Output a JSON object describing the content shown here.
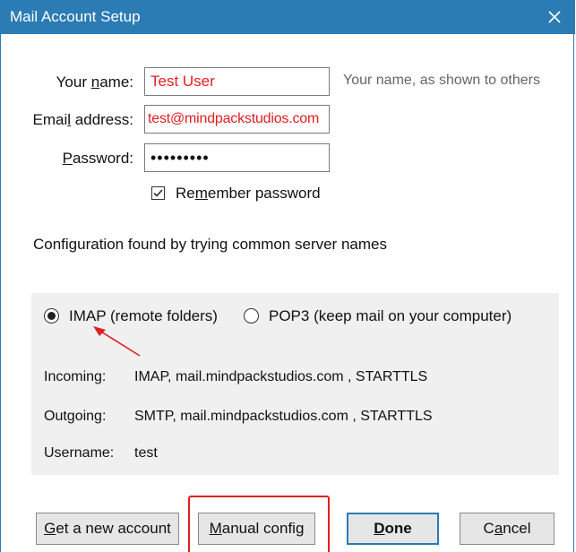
{
  "window": {
    "title": "Mail Account Setup"
  },
  "form": {
    "name_label_pre": "Your ",
    "name_label_key": "n",
    "name_label_post": "ame:",
    "name_value": "Test User",
    "name_hint": "Your name, as shown to others",
    "email_label_pre": "Emai",
    "email_label_key": "l",
    "email_label_post": " address:",
    "email_value": "test@mindpackstudios.com",
    "password_label_key": "P",
    "password_label_post": "assword:",
    "password_value": "•••••••••",
    "remember_pre": "Re",
    "remember_key": "m",
    "remember_post": "ember password",
    "remember_checked": true
  },
  "status": {
    "message": "Configuration found by trying common server names"
  },
  "config": {
    "imap_label": "IMAP (remote folders)",
    "pop3_label": "POP3 (keep mail on your computer)",
    "selected": "IMAP",
    "incoming_label": "Incoming:",
    "incoming_value": "IMAP, mail.mindpackstudios.com , STARTTLS",
    "outgoing_label": "Outgoing:",
    "outgoing_value": "SMTP, mail.mindpackstudios.com , STARTTLS",
    "username_label": "Username:",
    "username_value": "test"
  },
  "buttons": {
    "new_account_key": "G",
    "new_account_post": "et a new account",
    "manual_key": "M",
    "manual_post": "anual config",
    "done_key": "D",
    "done_post": "one",
    "cancel_pre": "C",
    "cancel_key": "a",
    "cancel_post": "ncel"
  },
  "annotations": {
    "color": "#e02020"
  },
  "colors": {
    "titlebar": "#2b7bb4",
    "field_text": "#e02020"
  }
}
